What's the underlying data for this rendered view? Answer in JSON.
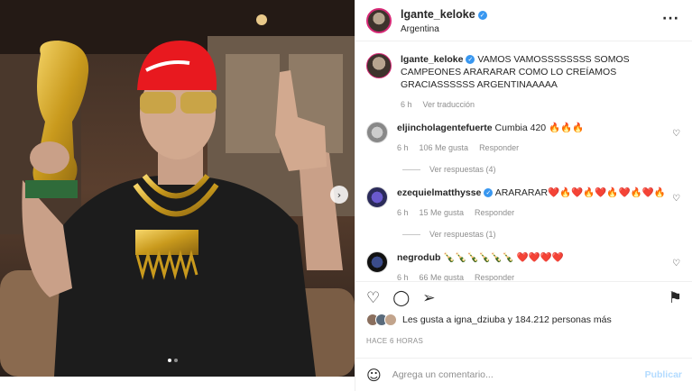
{
  "post": {
    "author": "lgante_keloke",
    "location": "Argentina",
    "more_icon": "more-horizontal-icon"
  },
  "caption": {
    "username": "lgante_keloke",
    "text": "VAMOS VAMOSSSSSSSS SOMOS CAMPEONES ARARARAR COMO LO CREÍAMOS GRACIASSSSSS ARGENTINAAAAA",
    "time": "6 h",
    "translate": "Ver traducción"
  },
  "comments": [
    {
      "username": "eljincholagentefuerte",
      "text": "Cumbia 420 🔥🔥🔥",
      "time": "6 h",
      "likes": "106 Me gusta",
      "reply": "Responder",
      "replies": "Ver respuestas (4)"
    },
    {
      "username": "ezequielmatthysse",
      "text": "ARARARAR❤️🔥❤️🔥❤️🔥❤️🔥❤️🔥",
      "time": "6 h",
      "likes": "15 Me gusta",
      "reply": "Responder",
      "replies": "Ver respuestas (1)"
    },
    {
      "username": "negrodub",
      "text": "🍾🍾🍾🍾🍾🍾 ❤️❤️❤️❤️",
      "time": "6 h",
      "likes": "66 Me gusta",
      "reply": "Responder"
    }
  ],
  "likes_text": "Les gusta a igna_dziuba y 184.212 personas más",
  "time_ago": "HACE 6 HORAS",
  "add_comment": {
    "placeholder": "Agrega un comentario...",
    "publish": "Publicar"
  },
  "colors": {
    "accent": "#3897f0",
    "muted": "#8e8e8e",
    "cap": "#e8191f"
  }
}
